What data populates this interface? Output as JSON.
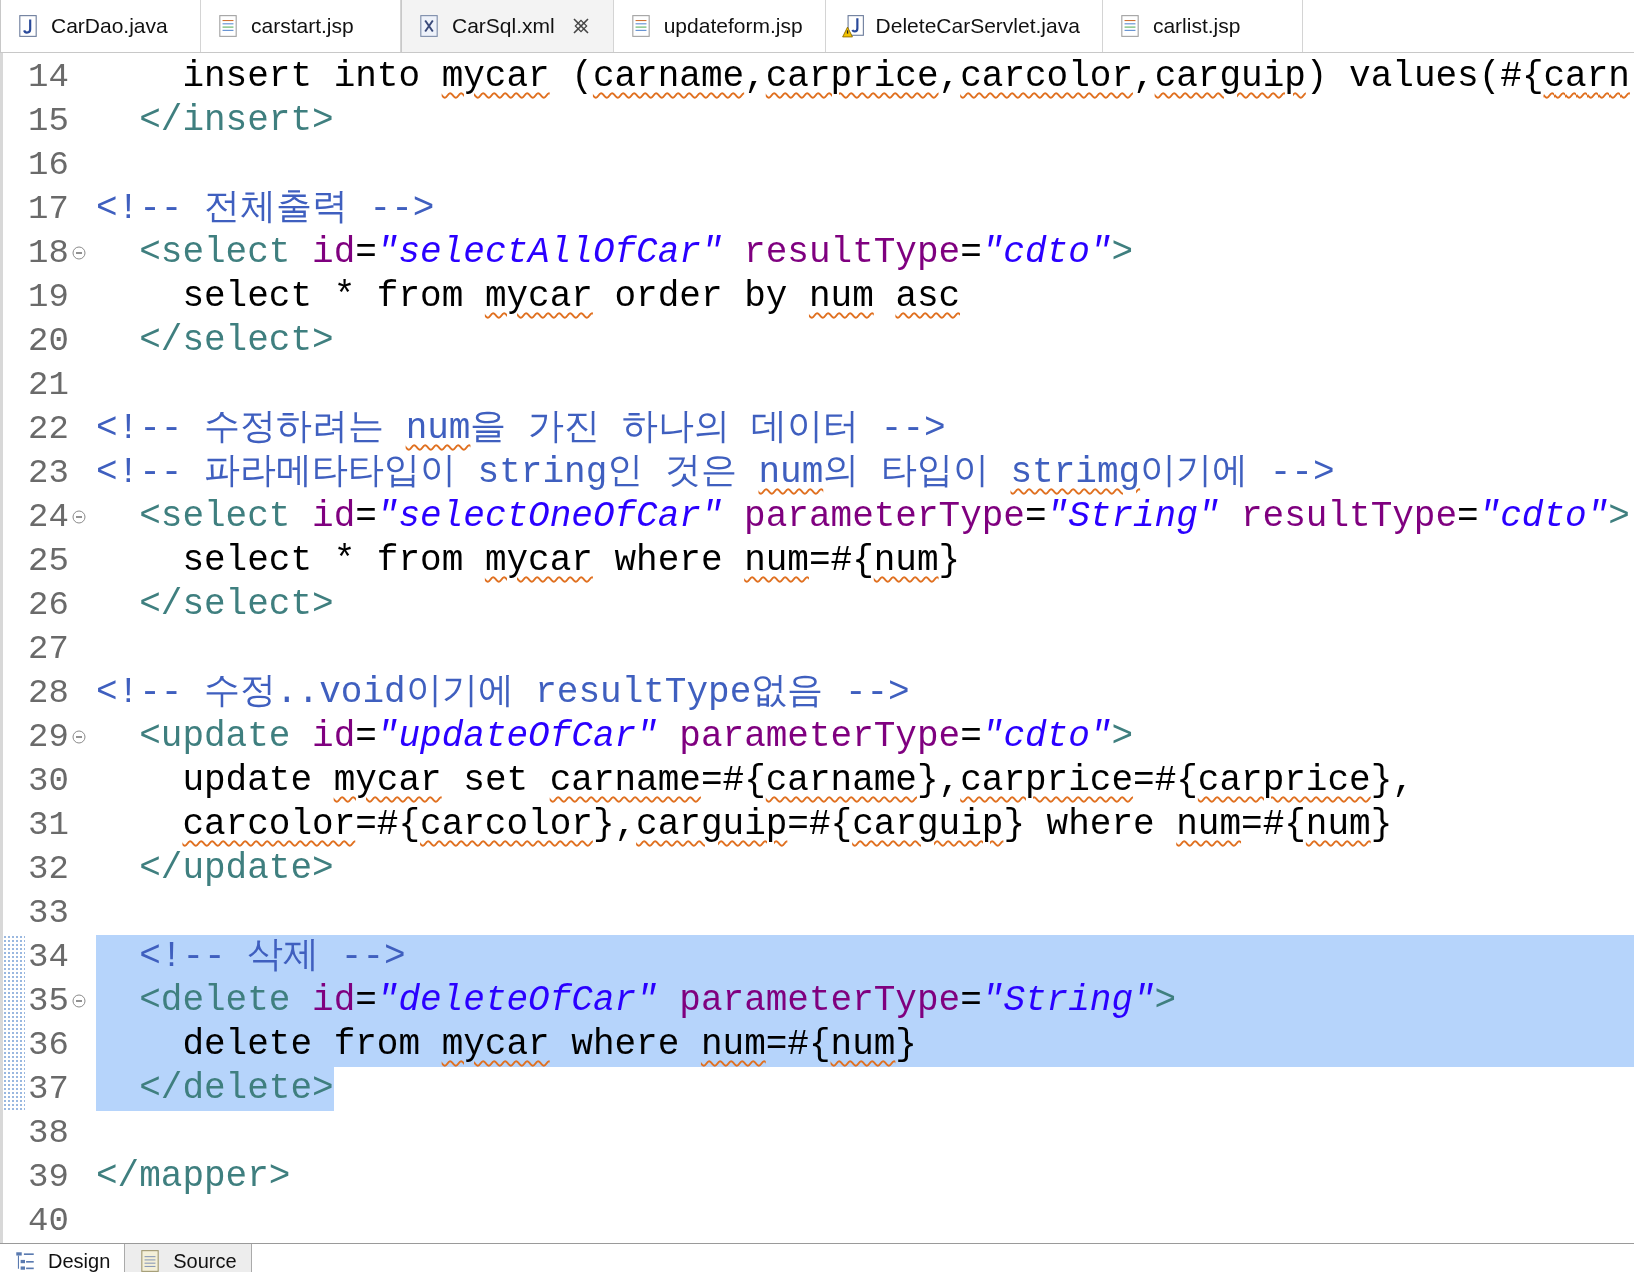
{
  "editor_tabs": [
    {
      "label": "CarDao.java",
      "kind": "java",
      "selected": false,
      "closable": false
    },
    {
      "label": "carstart.jsp",
      "kind": "jsp",
      "selected": false,
      "closable": false
    },
    {
      "label": "CarSql.xml",
      "kind": "xml",
      "selected": true,
      "closable": true
    },
    {
      "label": "updateform.jsp",
      "kind": "jsp",
      "selected": false,
      "closable": false
    },
    {
      "label": "DeleteCarServlet.java",
      "kind": "java-warning",
      "selected": false,
      "closable": false
    },
    {
      "label": "carlist.jsp",
      "kind": "jsp",
      "selected": false,
      "closable": false
    }
  ],
  "lines": [
    {
      "number": "14",
      "fold": false,
      "selected": false,
      "tokens": [
        {
          "kind": "plain",
          "text": "    insert into "
        },
        {
          "kind": "plain",
          "text": "mycar",
          "flagged": true
        },
        {
          "kind": "plain",
          "text": " ("
        },
        {
          "kind": "plain",
          "text": "carname",
          "flagged": true
        },
        {
          "kind": "plain",
          "text": ","
        },
        {
          "kind": "plain",
          "text": "carprice",
          "flagged": true
        },
        {
          "kind": "plain",
          "text": ","
        },
        {
          "kind": "plain",
          "text": "carcolor",
          "flagged": true
        },
        {
          "kind": "plain",
          "text": ","
        },
        {
          "kind": "plain",
          "text": "carguip",
          "flagged": true
        },
        {
          "kind": "plain",
          "text": ") values(#{"
        },
        {
          "kind": "plain",
          "text": "carn",
          "flagged": true
        }
      ]
    },
    {
      "number": "15",
      "fold": false,
      "selected": false,
      "tokens": [
        {
          "kind": "tag",
          "text": "  </insert>"
        }
      ]
    },
    {
      "number": "16",
      "fold": false,
      "selected": false
    },
    {
      "number": "17",
      "fold": false,
      "selected": false,
      "tokens": [
        {
          "kind": "comment",
          "text": "<!-- 전체출력 -->"
        }
      ]
    },
    {
      "number": "18",
      "fold": true,
      "selected": false,
      "tokens": [
        {
          "kind": "tag",
          "text": "  <select"
        },
        {
          "kind": "attr",
          "text": " id"
        },
        {
          "kind": "plain",
          "text": "="
        },
        {
          "kind": "value",
          "text": "\"selectAllOfCar\""
        },
        {
          "kind": "attr",
          "text": " resultType"
        },
        {
          "kind": "plain",
          "text": "="
        },
        {
          "kind": "value",
          "text": "\"cdto\""
        },
        {
          "kind": "tag",
          "text": ">"
        }
      ]
    },
    {
      "number": "19",
      "fold": false,
      "selected": false,
      "tokens": [
        {
          "kind": "plain",
          "text": "    select * from "
        },
        {
          "kind": "plain",
          "text": "mycar",
          "flagged": true
        },
        {
          "kind": "plain",
          "text": " order by "
        },
        {
          "kind": "plain",
          "text": "num",
          "flagged": true
        },
        {
          "kind": "plain",
          "text": " asc",
          "flagged": true
        }
      ]
    },
    {
      "number": "20",
      "fold": false,
      "selected": false,
      "tokens": [
        {
          "kind": "tag",
          "text": "  </select>"
        }
      ]
    },
    {
      "number": "21",
      "fold": false,
      "selected": false
    },
    {
      "number": "22",
      "fold": false,
      "selected": false,
      "tokens": [
        {
          "kind": "comment",
          "text": "<!-- 수정하려는 "
        },
        {
          "kind": "comment",
          "text": "num",
          "flagged": true
        },
        {
          "kind": "comment",
          "text": "을 가진 하나의 데이터 -->"
        }
      ]
    },
    {
      "number": "23",
      "fold": false,
      "selected": false,
      "tokens": [
        {
          "kind": "comment",
          "text": "<!-- 파라메타타입이 string인 것은 "
        },
        {
          "kind": "comment",
          "text": "num",
          "flagged": true
        },
        {
          "kind": "comment",
          "text": "의 타입이 "
        },
        {
          "kind": "comment",
          "text": "strimg",
          "flagged": true
        },
        {
          "kind": "comment",
          "text": "이기에 -->"
        }
      ]
    },
    {
      "number": "24",
      "fold": true,
      "selected": false,
      "tokens": [
        {
          "kind": "tag",
          "text": "  <select"
        },
        {
          "kind": "attr",
          "text": " id"
        },
        {
          "kind": "plain",
          "text": "="
        },
        {
          "kind": "value",
          "text": "\"selectOneOfCar\""
        },
        {
          "kind": "attr",
          "text": " parameterType"
        },
        {
          "kind": "plain",
          "text": "="
        },
        {
          "kind": "value",
          "text": "\"String\""
        },
        {
          "kind": "attr",
          "text": " resultType"
        },
        {
          "kind": "plain",
          "text": "="
        },
        {
          "kind": "value",
          "text": "\"cdto\""
        },
        {
          "kind": "tag",
          "text": ">"
        }
      ]
    },
    {
      "number": "25",
      "fold": false,
      "selected": false,
      "tokens": [
        {
          "kind": "plain",
          "text": "    select * from "
        },
        {
          "kind": "plain",
          "text": "mycar",
          "flagged": true
        },
        {
          "kind": "plain",
          "text": " where "
        },
        {
          "kind": "plain",
          "text": "num",
          "flagged": true
        },
        {
          "kind": "plain",
          "text": "=#{"
        },
        {
          "kind": "plain",
          "text": "num",
          "flagged": true
        },
        {
          "kind": "plain",
          "text": "}"
        }
      ]
    },
    {
      "number": "26",
      "fold": false,
      "selected": false,
      "tokens": [
        {
          "kind": "tag",
          "text": "  </select>"
        }
      ]
    },
    {
      "number": "27",
      "fold": false,
      "selected": false
    },
    {
      "number": "28",
      "fold": false,
      "selected": false,
      "tokens": [
        {
          "kind": "comment",
          "text": "<!-- 수정..void이기에 resultType없음 -->"
        }
      ]
    },
    {
      "number": "29",
      "fold": true,
      "selected": false,
      "tokens": [
        {
          "kind": "tag",
          "text": "  <update"
        },
        {
          "kind": "attr",
          "text": " id"
        },
        {
          "kind": "plain",
          "text": "="
        },
        {
          "kind": "value",
          "text": "\"updateOfCar\""
        },
        {
          "kind": "attr",
          "text": " parameterType"
        },
        {
          "kind": "plain",
          "text": "="
        },
        {
          "kind": "value",
          "text": "\"cdto\""
        },
        {
          "kind": "tag",
          "text": ">"
        }
      ]
    },
    {
      "number": "30",
      "fold": false,
      "selected": false,
      "tokens": [
        {
          "kind": "plain",
          "text": "    update "
        },
        {
          "kind": "plain",
          "text": "mycar",
          "flagged": true
        },
        {
          "kind": "plain",
          "text": " set "
        },
        {
          "kind": "plain",
          "text": "carname",
          "flagged": true
        },
        {
          "kind": "plain",
          "text": "=#{"
        },
        {
          "kind": "plain",
          "text": "carname",
          "flagged": true
        },
        {
          "kind": "plain",
          "text": "},"
        },
        {
          "kind": "plain",
          "text": "carprice",
          "flagged": true
        },
        {
          "kind": "plain",
          "text": "=#{"
        },
        {
          "kind": "plain",
          "text": "carprice",
          "flagged": true
        },
        {
          "kind": "plain",
          "text": "},"
        }
      ]
    },
    {
      "number": "31",
      "fold": false,
      "selected": false,
      "tokens": [
        {
          "kind": "plain",
          "text": "    carcolor",
          "flagged": true
        },
        {
          "kind": "plain",
          "text": "=#{"
        },
        {
          "kind": "plain",
          "text": "carcolor",
          "flagged": true
        },
        {
          "kind": "plain",
          "text": "},"
        },
        {
          "kind": "plain",
          "text": "carguip",
          "flagged": true
        },
        {
          "kind": "plain",
          "text": "=#{"
        },
        {
          "kind": "plain",
          "text": "carguip",
          "flagged": true
        },
        {
          "kind": "plain",
          "text": "} where "
        },
        {
          "kind": "plain",
          "text": "num",
          "flagged": true
        },
        {
          "kind": "plain",
          "text": "=#{"
        },
        {
          "kind": "plain",
          "text": "num",
          "flagged": true
        },
        {
          "kind": "plain",
          "text": "}"
        }
      ]
    },
    {
      "number": "32",
      "fold": false,
      "selected": false,
      "tokens": [
        {
          "kind": "tag",
          "text": "  </update>"
        }
      ]
    },
    {
      "number": "33",
      "fold": false,
      "selected": false
    },
    {
      "number": "34",
      "fold": false,
      "selected": true,
      "tokens": [
        {
          "kind": "comment",
          "text": "  <!-- 삭제 -->"
        }
      ]
    },
    {
      "number": "35",
      "fold": true,
      "selected": true,
      "tokens": [
        {
          "kind": "tag",
          "text": "  <delete"
        },
        {
          "kind": "attr",
          "text": " id"
        },
        {
          "kind": "plain",
          "text": "="
        },
        {
          "kind": "value",
          "text": "\"deleteOfCar\""
        },
        {
          "kind": "attr",
          "text": " parameterType"
        },
        {
          "kind": "plain",
          "text": "="
        },
        {
          "kind": "value",
          "text": "\"String\""
        },
        {
          "kind": "tag",
          "text": ">"
        }
      ]
    },
    {
      "number": "36",
      "fold": false,
      "selected": true,
      "tokens": [
        {
          "kind": "plain",
          "text": "    delete from "
        },
        {
          "kind": "plain",
          "text": "mycar",
          "flagged": true
        },
        {
          "kind": "plain",
          "text": " where "
        },
        {
          "kind": "plain",
          "text": "num",
          "flagged": true
        },
        {
          "kind": "plain",
          "text": "=#{"
        },
        {
          "kind": "plain",
          "text": "num",
          "flagged": true
        },
        {
          "kind": "plain",
          "text": "}"
        }
      ]
    },
    {
      "number": "37",
      "fold": false,
      "selected": true,
      "tokens": [
        {
          "kind": "tag",
          "text": "  </delete>"
        }
      ]
    },
    {
      "number": "38",
      "fold": false,
      "selected": false
    },
    {
      "number": "39",
      "fold": false,
      "selected": false,
      "tokens": [
        {
          "kind": "tag",
          "text": "</mapper>"
        }
      ]
    },
    {
      "number": "40",
      "fold": false,
      "selected": false
    }
  ],
  "view_tabs": [
    {
      "label": "Design",
      "kind": "design",
      "selected": false
    },
    {
      "label": "Source",
      "kind": "source",
      "selected": true
    }
  ]
}
